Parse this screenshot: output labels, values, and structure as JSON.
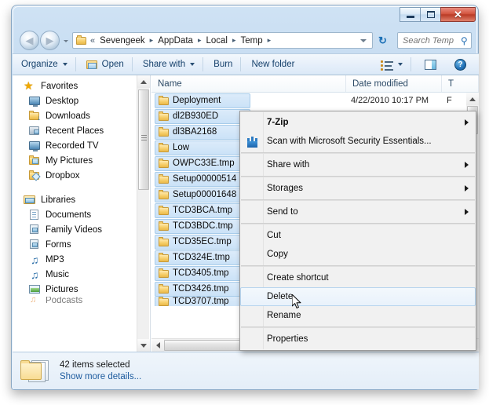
{
  "window": {
    "controls": {
      "minimize_label": "–",
      "maximize_label": "□",
      "close_label": "✕"
    }
  },
  "address_bar": {
    "back_label": "◀",
    "forward_label": "▶",
    "chevrons": "«",
    "breadcrumbs": [
      "Sevengeek",
      "AppData",
      "Local",
      "Temp"
    ],
    "separator": "▸",
    "dropdown_label": "▼",
    "refresh_label": "↻"
  },
  "search": {
    "placeholder": "Search Temp",
    "value": "",
    "icon_label": "⚲"
  },
  "toolbar": {
    "organize_label": "Organize",
    "open_label": "Open",
    "share_with_label": "Share with",
    "burn_label": "Burn",
    "new_folder_label": "New folder",
    "help_label": "?"
  },
  "nav_pane": {
    "groups": [
      {
        "header": "Favorites",
        "header_icon": "star-icon",
        "items": [
          {
            "label": "Desktop",
            "icon": "desktop-icon"
          },
          {
            "label": "Downloads",
            "icon": "downloads-folder-icon"
          },
          {
            "label": "Recent Places",
            "icon": "recent-places-icon"
          },
          {
            "label": "Recorded TV",
            "icon": "recorded-tv-icon"
          },
          {
            "label": "My Pictures",
            "icon": "my-pictures-folder-icon"
          },
          {
            "label": "Dropbox",
            "icon": "dropbox-folder-icon"
          }
        ]
      },
      {
        "header": "Libraries",
        "header_icon": "libraries-icon",
        "items": [
          {
            "label": "Documents",
            "icon": "documents-icon"
          },
          {
            "label": "Family Videos",
            "icon": "video-library-icon"
          },
          {
            "label": "Forms",
            "icon": "video-library-icon"
          },
          {
            "label": "MP3",
            "icon": "music-note-icon"
          },
          {
            "label": "Music",
            "icon": "music-note-icon"
          },
          {
            "label": "Pictures",
            "icon": "picture-library-icon"
          },
          {
            "label": "Podcasts",
            "icon": "podcast-icon",
            "partial": true
          }
        ]
      }
    ]
  },
  "file_list": {
    "columns": [
      {
        "key": "name",
        "label": "Name"
      },
      {
        "key": "date",
        "label": "Date modified"
      },
      {
        "key": "type",
        "label": "T"
      }
    ],
    "rows": [
      {
        "name": "Deployment",
        "date": "4/22/2010 10:17 PM",
        "type": "F",
        "selected": true
      },
      {
        "name": "dl2B930ED",
        "date": "",
        "type": "",
        "selected": true
      },
      {
        "name": "dl3BA2168",
        "date": "",
        "type": "",
        "selected": true
      },
      {
        "name": "Low",
        "date": "",
        "type": "",
        "selected": true
      },
      {
        "name": "OWPC33E.tmp",
        "date": "",
        "type": "",
        "selected": true
      },
      {
        "name": "Setup00000514",
        "date": "",
        "type": "",
        "selected": true
      },
      {
        "name": "Setup00001648",
        "date": "",
        "type": "",
        "selected": true
      },
      {
        "name": "TCD3BCA.tmp",
        "date": "",
        "type": "",
        "selected": true
      },
      {
        "name": "TCD3BDC.tmp",
        "date": "",
        "type": "",
        "selected": true
      },
      {
        "name": "TCD35EC.tmp",
        "date": "",
        "type": "",
        "selected": true
      },
      {
        "name": "TCD324E.tmp",
        "date": "",
        "type": "",
        "selected": true
      },
      {
        "name": "TCD3405.tmp",
        "date": "",
        "type": "",
        "selected": true
      },
      {
        "name": "TCD3426.tmp",
        "date": "",
        "type": "",
        "selected": true
      },
      {
        "name": "TCD3707.tmp",
        "date": "",
        "type": "",
        "selected": true,
        "clipped": true
      }
    ]
  },
  "context_menu": {
    "items": [
      {
        "label": "7-Zip",
        "bold": true,
        "submenu": true,
        "separator_after": false
      },
      {
        "label": "Scan with Microsoft Security Essentials...",
        "icon": "security-shield-icon",
        "submenu": false,
        "separator_after": true
      },
      {
        "label": "Share with",
        "submenu": true,
        "separator_after": true
      },
      {
        "label": "Storages",
        "submenu": true,
        "separator_after": true
      },
      {
        "label": "Send to",
        "submenu": true,
        "separator_after": true
      },
      {
        "label": "Cut",
        "submenu": false,
        "separator_after": false
      },
      {
        "label": "Copy",
        "submenu": false,
        "separator_after": true
      },
      {
        "label": "Create shortcut",
        "submenu": false,
        "separator_after": false
      },
      {
        "label": "Delete",
        "submenu": false,
        "selected": true,
        "separator_after": false
      },
      {
        "label": "Rename",
        "submenu": false,
        "separator_after": true
      },
      {
        "label": "Properties",
        "submenu": false,
        "separator_after": false
      }
    ]
  },
  "details_bar": {
    "title": "42 items selected",
    "link": "Show more details..."
  },
  "colors": {
    "selection_fill": "#cbe2f7",
    "selection_border": "#a8ccea",
    "accent_link": "#1d5b9e",
    "close_button": "#b93b26",
    "menu_background": "#f1f1f1"
  }
}
